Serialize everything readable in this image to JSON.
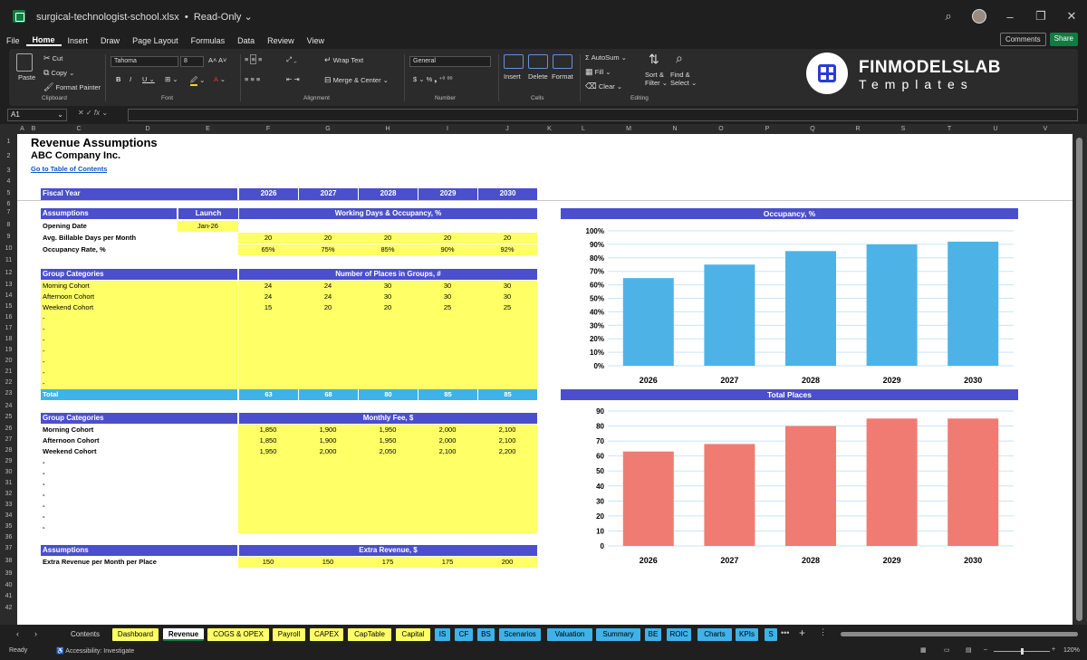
{
  "window": {
    "filename": "surgical-technologist-school.xlsx",
    "mode": "Read-Only"
  },
  "menu": [
    "File",
    "Home",
    "Insert",
    "Draw",
    "Page Layout",
    "Formulas",
    "Data",
    "Review",
    "View"
  ],
  "menu_active": "Home",
  "menu_right": {
    "comments": "Comments",
    "share": "Share"
  },
  "ribbon": {
    "clipboard": {
      "paste": "Paste",
      "cut": "Cut",
      "copy": "Copy",
      "format_painter": "Format Painter",
      "group": "Clipboard"
    },
    "font": {
      "name": "Tahoma",
      "size": "8",
      "group": "Font"
    },
    "alignment": {
      "wrap": "Wrap Text",
      "merge": "Merge & Center",
      "group": "Alignment"
    },
    "number": {
      "format": "General",
      "group": "Number"
    },
    "cells": {
      "insert": "Insert",
      "delete": "Delete",
      "format": "Format",
      "group": "Cells"
    },
    "editing": {
      "autosum": "AutoSum",
      "fill": "Fill",
      "clear": "Clear",
      "sort1": "Sort &",
      "sort2": "Filter",
      "find1": "Find &",
      "find2": "Select",
      "group": "Editing"
    }
  },
  "logo": {
    "line1": "FINMODELSLAB",
    "line2": "Templates"
  },
  "formula_bar": {
    "name_box": "A1",
    "fx": "fx",
    "value": ""
  },
  "columns": [
    "A",
    "B",
    "C",
    "D",
    "E",
    "F",
    "G",
    "H",
    "I",
    "J",
    "K",
    "L",
    "M",
    "N",
    "O",
    "P",
    "Q",
    "R",
    "S",
    "T",
    "U",
    "V"
  ],
  "sheet": {
    "title": "Revenue Assumptions",
    "company": "ABC Company Inc.",
    "toc_link": "Go to Table of Contents",
    "fiscal_year_label": "Fiscal Year",
    "years": [
      "2026",
      "2027",
      "2028",
      "2029",
      "2030"
    ],
    "assumptions": {
      "header": "Assumptions",
      "launch_header": "Launch",
      "right_header": "Working Days & Occupancy, %",
      "opening_date_label": "Opening Date",
      "opening_date": "Jan-26",
      "billable_label": "Avg. Billable Days per Month",
      "billable": [
        "20",
        "20",
        "20",
        "20",
        "20"
      ],
      "occupancy_label": "Occupancy Rate, %",
      "occupancy": [
        "65%",
        "75%",
        "85%",
        "90%",
        "92%"
      ]
    },
    "places": {
      "header": "Group Categories",
      "right_header": "Number of Places in Groups, #",
      "rows": [
        {
          "label": "Morning Cohort",
          "values": [
            "24",
            "24",
            "30",
            "30",
            "30"
          ]
        },
        {
          "label": "Afternoon Cohort",
          "values": [
            "24",
            "24",
            "30",
            "30",
            "30"
          ]
        },
        {
          "label": "Weekend Cohort",
          "values": [
            "15",
            "20",
            "20",
            "25",
            "25"
          ]
        }
      ],
      "empty_rows": [
        "-",
        "-",
        "-",
        "-",
        "-",
        "-",
        "-"
      ],
      "total_label": "Total",
      "totals": [
        "63",
        "68",
        "80",
        "85",
        "85"
      ]
    },
    "fees": {
      "header": "Group Categories",
      "right_header": "Monthly Fee, $",
      "rows": [
        {
          "label": "Morning Cohort",
          "values": [
            "1,850",
            "1,900",
            "1,950",
            "2,000",
            "2,100"
          ]
        },
        {
          "label": "Afternoon Cohort",
          "values": [
            "1,850",
            "1,900",
            "1,950",
            "2,000",
            "2,100"
          ]
        },
        {
          "label": "Weekend Cohort",
          "values": [
            "1,950",
            "2,000",
            "2,050",
            "2,100",
            "2,200"
          ]
        }
      ],
      "empty_rows": [
        "-",
        "-",
        "-",
        "-",
        "-",
        "-",
        "-"
      ]
    },
    "extra": {
      "header": "Assumptions",
      "right_header": "Extra Revenue, $",
      "label": "Extra Revenue per Month per Place",
      "values": [
        "150",
        "150",
        "175",
        "175",
        "200"
      ]
    }
  },
  "chart_data": [
    {
      "type": "bar",
      "title": "Occupancy, %",
      "categories": [
        "2026",
        "2027",
        "2028",
        "2029",
        "2030"
      ],
      "values": [
        65,
        75,
        85,
        90,
        92
      ],
      "ylim": [
        0,
        100
      ],
      "yticks": [
        "0%",
        "10%",
        "20%",
        "30%",
        "40%",
        "50%",
        "60%",
        "70%",
        "80%",
        "90%",
        "100%"
      ],
      "color": "#4db3e6",
      "grid": true
    },
    {
      "type": "bar",
      "title": "Total Places",
      "categories": [
        "2026",
        "2027",
        "2028",
        "2029",
        "2030"
      ],
      "values": [
        63,
        68,
        80,
        85,
        85
      ],
      "ylim": [
        0,
        90
      ],
      "yticks": [
        "0",
        "10",
        "20",
        "30",
        "40",
        "50",
        "60",
        "70",
        "80",
        "90"
      ],
      "color": "#f07b72",
      "grid": true
    }
  ],
  "tabs": [
    {
      "label": "Contents",
      "color": "#1f1f1f",
      "text": "#ddd"
    },
    {
      "label": "Dashboard",
      "color": "#ffff66",
      "text": "#000"
    },
    {
      "label": "Revenue",
      "color": "#ffffff",
      "text": "#000",
      "active": true
    },
    {
      "label": "COGS & OPEX",
      "color": "#ffff66",
      "text": "#000"
    },
    {
      "label": "Payroll",
      "color": "#ffff66",
      "text": "#000"
    },
    {
      "label": "CAPEX",
      "color": "#ffff66",
      "text": "#000"
    },
    {
      "label": "CapTable",
      "color": "#ffff66",
      "text": "#000"
    },
    {
      "label": "Capital",
      "color": "#ffff66",
      "text": "#000"
    },
    {
      "label": "IS",
      "color": "#3fb2e8",
      "text": "#000"
    },
    {
      "label": "CF",
      "color": "#3fb2e8",
      "text": "#000"
    },
    {
      "label": "BS",
      "color": "#3fb2e8",
      "text": "#000"
    },
    {
      "label": "Scenarios",
      "color": "#3fb2e8",
      "text": "#000"
    },
    {
      "label": "Valuation",
      "color": "#3fb2e8",
      "text": "#000"
    },
    {
      "label": "Summary",
      "color": "#3fb2e8",
      "text": "#000"
    },
    {
      "label": "BE",
      "color": "#3fb2e8",
      "text": "#000"
    },
    {
      "label": "ROIC",
      "color": "#3fb2e8",
      "text": "#000"
    },
    {
      "label": "Charts",
      "color": "#3fb2e8",
      "text": "#000"
    },
    {
      "label": "KPIs",
      "color": "#3fb2e8",
      "text": "#000"
    },
    {
      "label": "S",
      "color": "#3fb2e8",
      "text": "#000"
    }
  ],
  "status": {
    "ready": "Ready",
    "accessibility": "Accessibility: Investigate",
    "zoom": "120%"
  }
}
